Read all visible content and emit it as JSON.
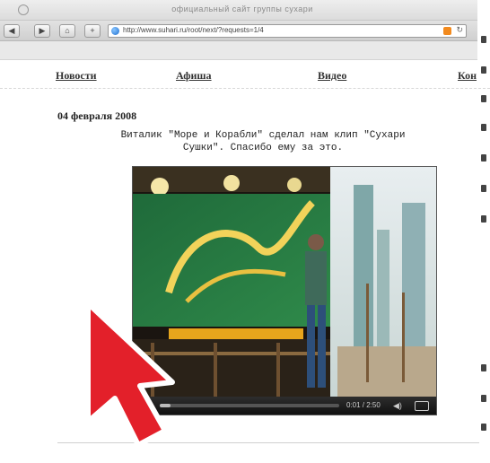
{
  "browser": {
    "window_title": "официальный сайт группы сухари",
    "url": "http://www.suhari.ru/root/next/?requests=1/4",
    "back_label": "◀",
    "forward_label": "▶",
    "home_label": "⌂",
    "add_label": "+"
  },
  "nav": {
    "items": [
      "Новости",
      "Афиша",
      "Видео",
      "Кон"
    ]
  },
  "post": {
    "date": "04 февраля 2008",
    "line1": "Виталик \"Море и Корабли\" сделал нам клип \"Сухари",
    "line2": "Сушки\". Спасибо ему за это."
  },
  "video": {
    "time": "0:01 / 2:50",
    "volume_icon": "speaker-icon",
    "progress_fraction": 0.06
  },
  "colors": {
    "arrow_fill": "#e3202a",
    "arrow_outline": "#ffffff"
  }
}
